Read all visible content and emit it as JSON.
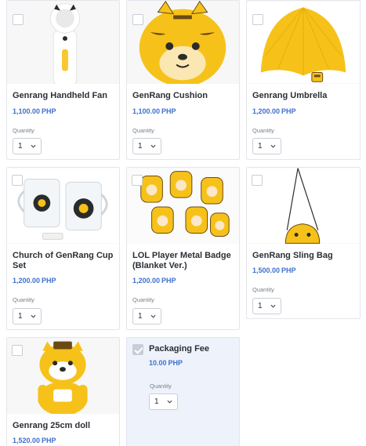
{
  "currency": "PHP",
  "quantity_label": "Quantity",
  "products": [
    {
      "name": "Genrang Handheld Fan",
      "price": "1,100.00",
      "quantity": "1",
      "checked": false,
      "image_icon": "handheld-fan-image"
    },
    {
      "name": "GenRang Cushion",
      "price": "1,100.00",
      "quantity": "1",
      "checked": false,
      "image_icon": "tiger-cushion-image"
    },
    {
      "name": "Genrang Umbrella",
      "price": "1,200.00",
      "quantity": "1",
      "checked": false,
      "image_icon": "yellow-umbrella-image"
    },
    {
      "name": "Church of GenRang Cup Set",
      "price": "1,200.00",
      "quantity": "1",
      "checked": false,
      "image_icon": "cup-set-image"
    },
    {
      "name": "LOL Player Metal Badge (Blanket Ver.)",
      "price": "1,200.00",
      "quantity": "1",
      "checked": false,
      "image_icon": "metal-badges-image"
    },
    {
      "name": "GenRang Sling Bag",
      "price": "1,500.00",
      "quantity": "1",
      "checked": false,
      "image_icon": "sling-bag-image"
    },
    {
      "name": "Genrang 25cm doll",
      "price": "1,520.00",
      "quantity": "1",
      "checked": false,
      "image_icon": "tiger-doll-image"
    }
  ],
  "packaging": {
    "name": "Packaging Fee",
    "price": "10.00",
    "quantity": "1",
    "checked": true
  },
  "colors": {
    "accent": "#3f6fcf",
    "brand_yellow": "#f6c21a",
    "fee_bg": "#eef2fb"
  }
}
